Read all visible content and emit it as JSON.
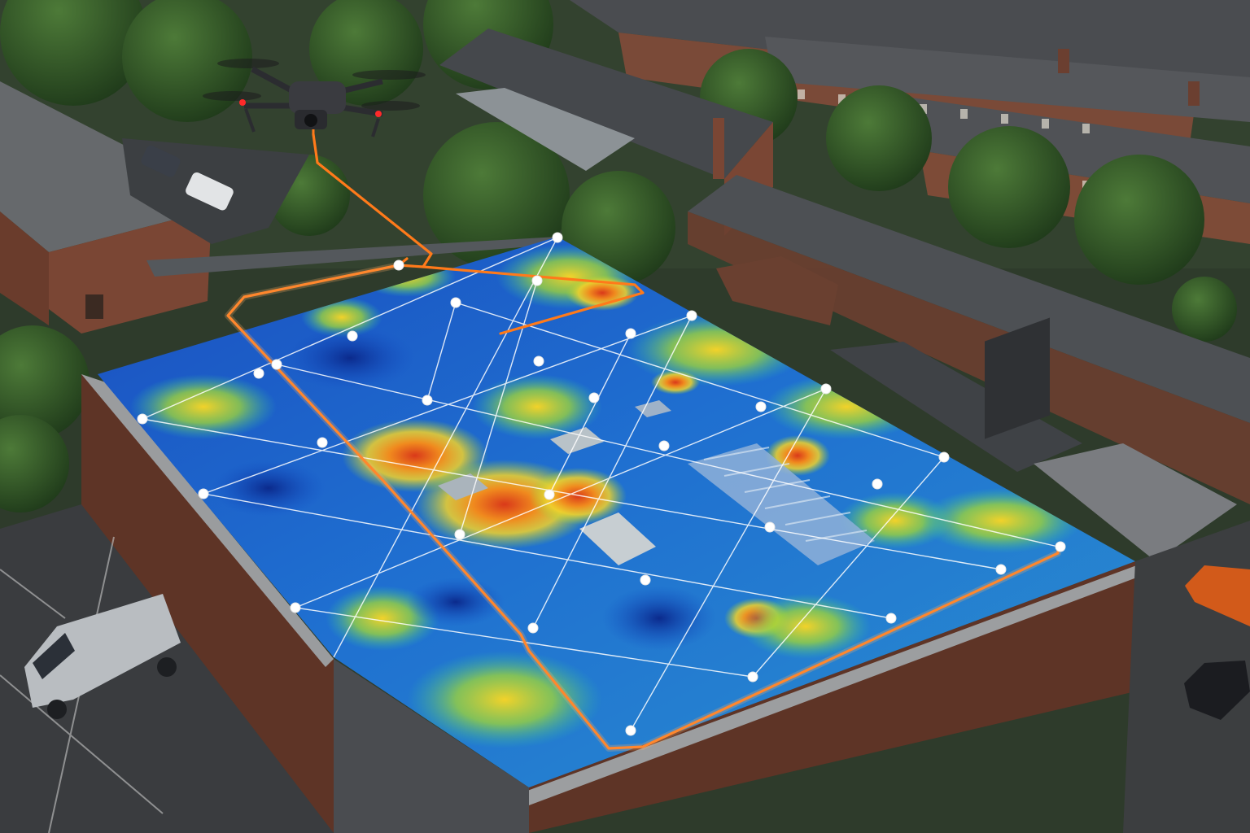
{
  "scene": {
    "kind": "aerial-photograph",
    "subject": "thermal-roof-inspection",
    "heatmap_palette": [
      "#0b2a8c",
      "#1450c8",
      "#1f8fd6",
      "#2fc0a8",
      "#9bd33c",
      "#f2d22a",
      "#f08a1e",
      "#d9391a"
    ],
    "flight_path_color": "#ff7a1a",
    "survey_grid_color": "#ffffff",
    "waypoint_color": "#ffffff",
    "icons": [
      "drone-icon",
      "waypoint-icon",
      "van-icon",
      "car-icon",
      "tree-icon",
      "skylight-icon",
      "roof-vent-icon"
    ]
  }
}
